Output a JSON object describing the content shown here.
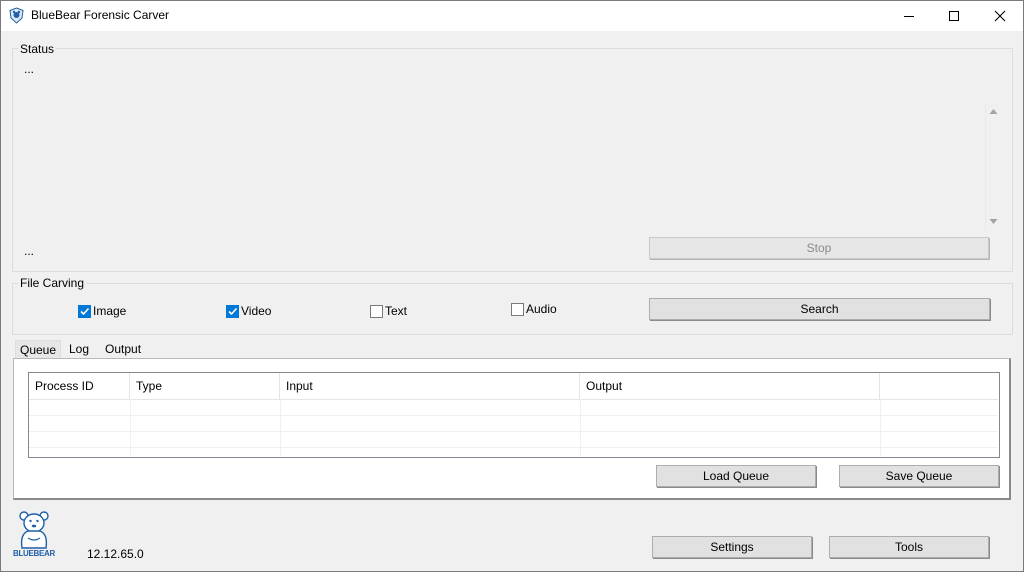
{
  "window": {
    "title": "BlueBear Forensic Carver",
    "minimize_icon": "minimize-icon",
    "maximize_icon": "maximize-icon",
    "close_icon": "close-icon"
  },
  "status": {
    "legend": "Status",
    "line_top": "...",
    "line_bottom": "...",
    "stop_label": "Stop"
  },
  "carving": {
    "legend": "File Carving",
    "options": [
      {
        "label": "Image",
        "checked": true
      },
      {
        "label": "Video",
        "checked": true
      },
      {
        "label": "Text",
        "checked": false
      },
      {
        "label": "Audio",
        "checked": false
      }
    ],
    "search_label": "Search"
  },
  "tabs": [
    {
      "label": "Queue",
      "active": true
    },
    {
      "label": "Log",
      "active": false
    },
    {
      "label": "Output",
      "active": false
    }
  ],
  "queue": {
    "columns": [
      "Process ID",
      "Type",
      "Input",
      "Output"
    ],
    "rows": [],
    "load_label": "Load Queue",
    "save_label": "Save Queue"
  },
  "footer": {
    "logo_text": "BLUEBEAR",
    "version": "12.12.65.0",
    "settings_label": "Settings",
    "tools_label": "Tools"
  },
  "colors": {
    "accent": "#0078d7",
    "logo_blue": "#1f5fa8"
  }
}
